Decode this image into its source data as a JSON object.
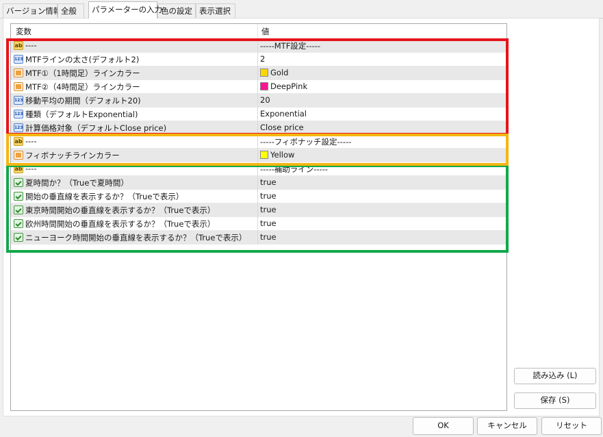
{
  "tabs": [
    {
      "label": "バージョン情報",
      "active": false
    },
    {
      "label": "全般",
      "active": false
    },
    {
      "label": "パラメーターの入力",
      "active": true
    },
    {
      "label": "色の設定",
      "active": false
    },
    {
      "label": "表示選択",
      "active": false
    }
  ],
  "table": {
    "col_variable": "変数",
    "col_value": "値",
    "rows": [
      {
        "icon": "ab",
        "name": "----",
        "value": "-----MTF設定-----"
      },
      {
        "icon": "123",
        "name": "MTFラインの太さ(デフォルト2)",
        "value": "2"
      },
      {
        "icon": "color",
        "name": "MTF①（1時間足）ラインカラー",
        "value": "Gold",
        "swatch": "#FFD700"
      },
      {
        "icon": "color",
        "name": "MTF②（4時間足）ラインカラー",
        "value": "DeepPink",
        "swatch": "#FF1493"
      },
      {
        "icon": "123",
        "name": "移動平均の期間（デフォルト20)",
        "value": "20"
      },
      {
        "icon": "123",
        "name": "種類（デフォルトExponential)",
        "value": "Exponential"
      },
      {
        "icon": "123",
        "name": "計算価格対象（デフォルトClose price)",
        "value": "Close price"
      },
      {
        "icon": "ab",
        "name": "----",
        "value": "-----フィボナッチ設定-----"
      },
      {
        "icon": "color",
        "name": "フィボナッチラインカラー",
        "value": "Yellow",
        "swatch": "#FFFF00"
      },
      {
        "icon": "ab",
        "name": "----",
        "value": "-----補助ライン-----"
      },
      {
        "icon": "bool",
        "name": "夏時間か？（Trueで夏時間）",
        "value": "true"
      },
      {
        "icon": "bool",
        "name": "開始の垂直線を表示するか？（Trueで表示）",
        "value": "true"
      },
      {
        "icon": "bool",
        "name": "東京時間開始の垂直線を表示するか？（Trueで表示）",
        "value": "true"
      },
      {
        "icon": "bool",
        "name": "欧州時間開始の垂直線を表示するか？（Trueで表示）",
        "value": "true"
      },
      {
        "icon": "bool",
        "name": "ニューヨーク時間開始の垂直線を表示するか？（Trueで表示）",
        "value": "true"
      }
    ]
  },
  "highlight_colors": {
    "mtf": "#E5141B",
    "fibo": "#F5B512",
    "aux": "#12A84A"
  },
  "buttons": {
    "load": "読み込み (L)",
    "save": "保存 (S)",
    "ok": "OK",
    "cancel": "キャンセル",
    "reset": "リセット"
  }
}
